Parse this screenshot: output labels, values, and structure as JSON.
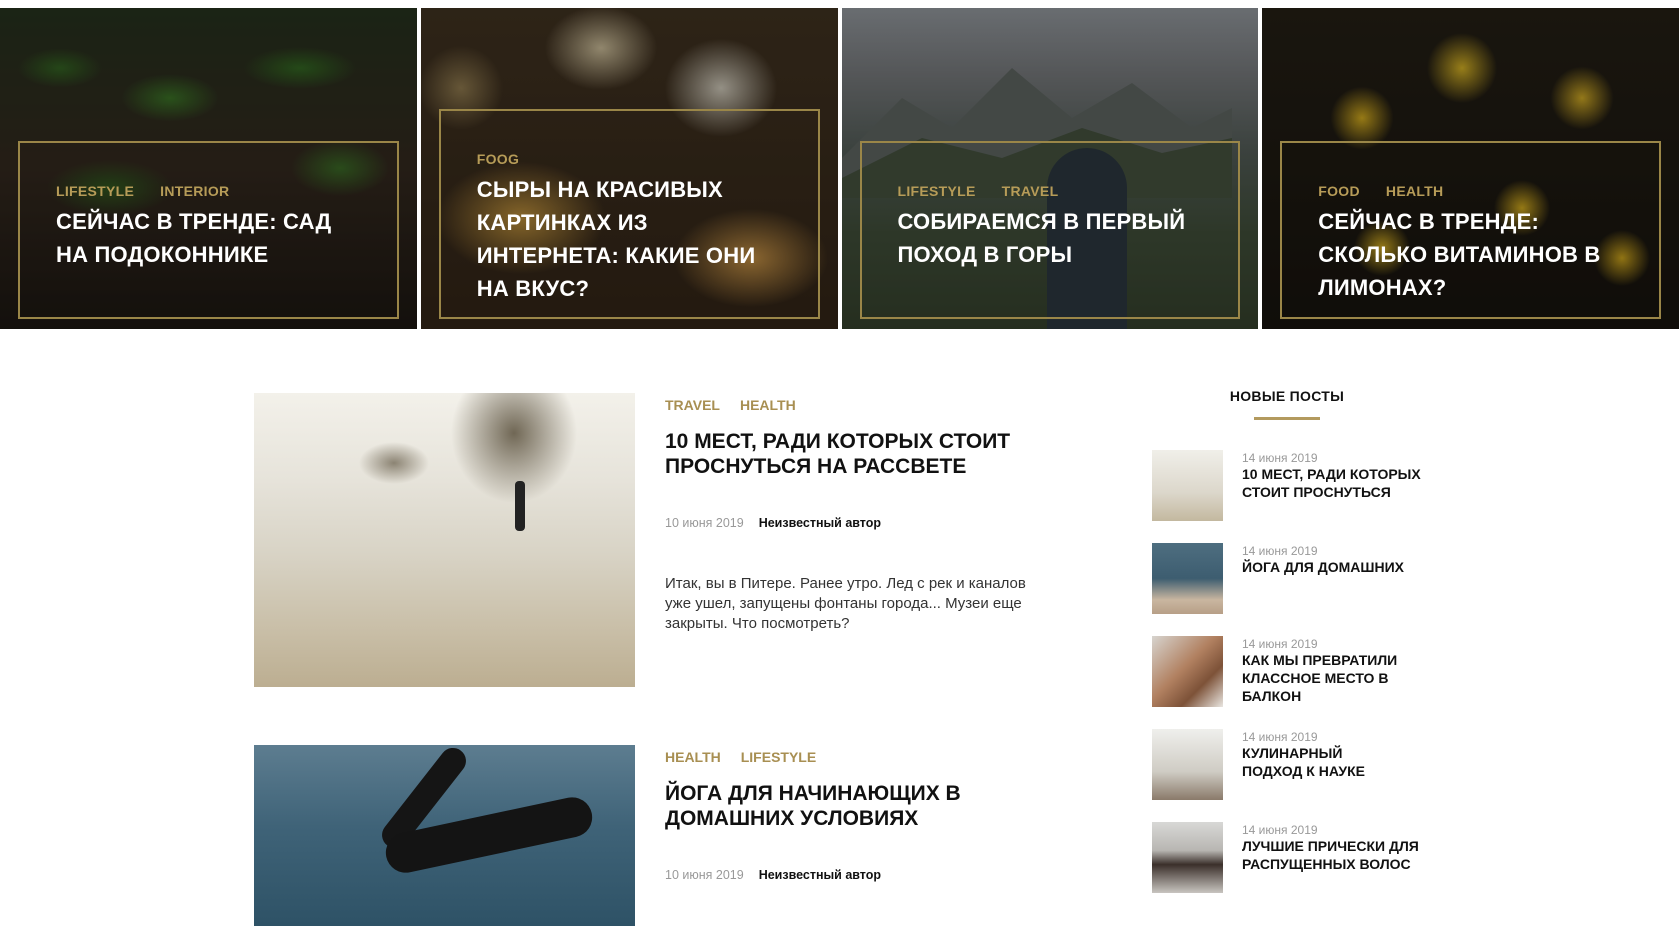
{
  "hero": [
    {
      "categories": [
        "LIFESTYLE",
        "INTERIOR"
      ],
      "title": "СЕЙЧАС В ТРЕНДЕ: САД НА ПОДОКОННИКЕ"
    },
    {
      "categories": [
        "FOOG"
      ],
      "title": "СЫРЫ НА КРАСИВЫХ КАРТИНКАХ ИЗ ИНТЕРНЕТА: КАКИЕ ОНИ НА ВКУС?"
    },
    {
      "categories": [
        "LIFESTYLE",
        "TRAVEL"
      ],
      "title": "СОБИРАЕМСЯ В ПЕРВЫЙ ПОХОД В ГОРЫ"
    },
    {
      "categories": [
        "FOOD",
        "HEALTH"
      ],
      "title": "СЕЙЧАС В ТРЕНДЕ: СКОЛЬКО ВИТАМИНОВ В ЛИМОНАХ?"
    }
  ],
  "posts": [
    {
      "categories": [
        "TRAVEL",
        "HEALTH"
      ],
      "title": "10 МЕСТ, РАДИ КОТОРЫХ СТОИТ ПРОСНУТЬСЯ НА РАССВЕТЕ",
      "date": "10 июня 2019",
      "author": "Неизвестный автор",
      "excerpt": "Итак, вы в Питере. Ранее утро. Лед с рек и каналов уже ушел, запущены фонтаны города... Музеи еще закрыты. Что посмотреть?"
    },
    {
      "categories": [
        "HEALTH",
        "LIFESTYLE"
      ],
      "title": "ЙОГА ДЛЯ НАЧИНАЮЩИХ В ДОМАШНИХ УСЛОВИЯХ",
      "date": "10 июня 2019",
      "author": "Неизвестный автор"
    }
  ],
  "sidebar": {
    "title": "НОВЫЕ ПОСТЫ",
    "items": [
      {
        "date": "14 июня 2019",
        "title": "10 МЕСТ, РАДИ КОТОРЫХ СТОИТ ПРОСНУТЬСЯ"
      },
      {
        "date": "14 июня 2019",
        "title": "ЙОГА ДЛЯ ДОМАШНИХ"
      },
      {
        "date": "14 июня 2019",
        "title": "КАК МЫ ПРЕВРАТИЛИ КЛАССНОЕ МЕСТО В БАЛКОН"
      },
      {
        "date": "14 июня 2019",
        "title": "КУЛИНАРНЫЙ ПОДХОД К НАУКЕ"
      },
      {
        "date": "14 июня 2019",
        "title": "ЛУЧШИЕ ПРИЧЕСКИ ДЛЯ РАСПУЩЕННЫХ ВОЛОС"
      }
    ]
  },
  "colors": {
    "accent": "#b39a5e",
    "category": "#a88f52",
    "text": "#111111"
  }
}
